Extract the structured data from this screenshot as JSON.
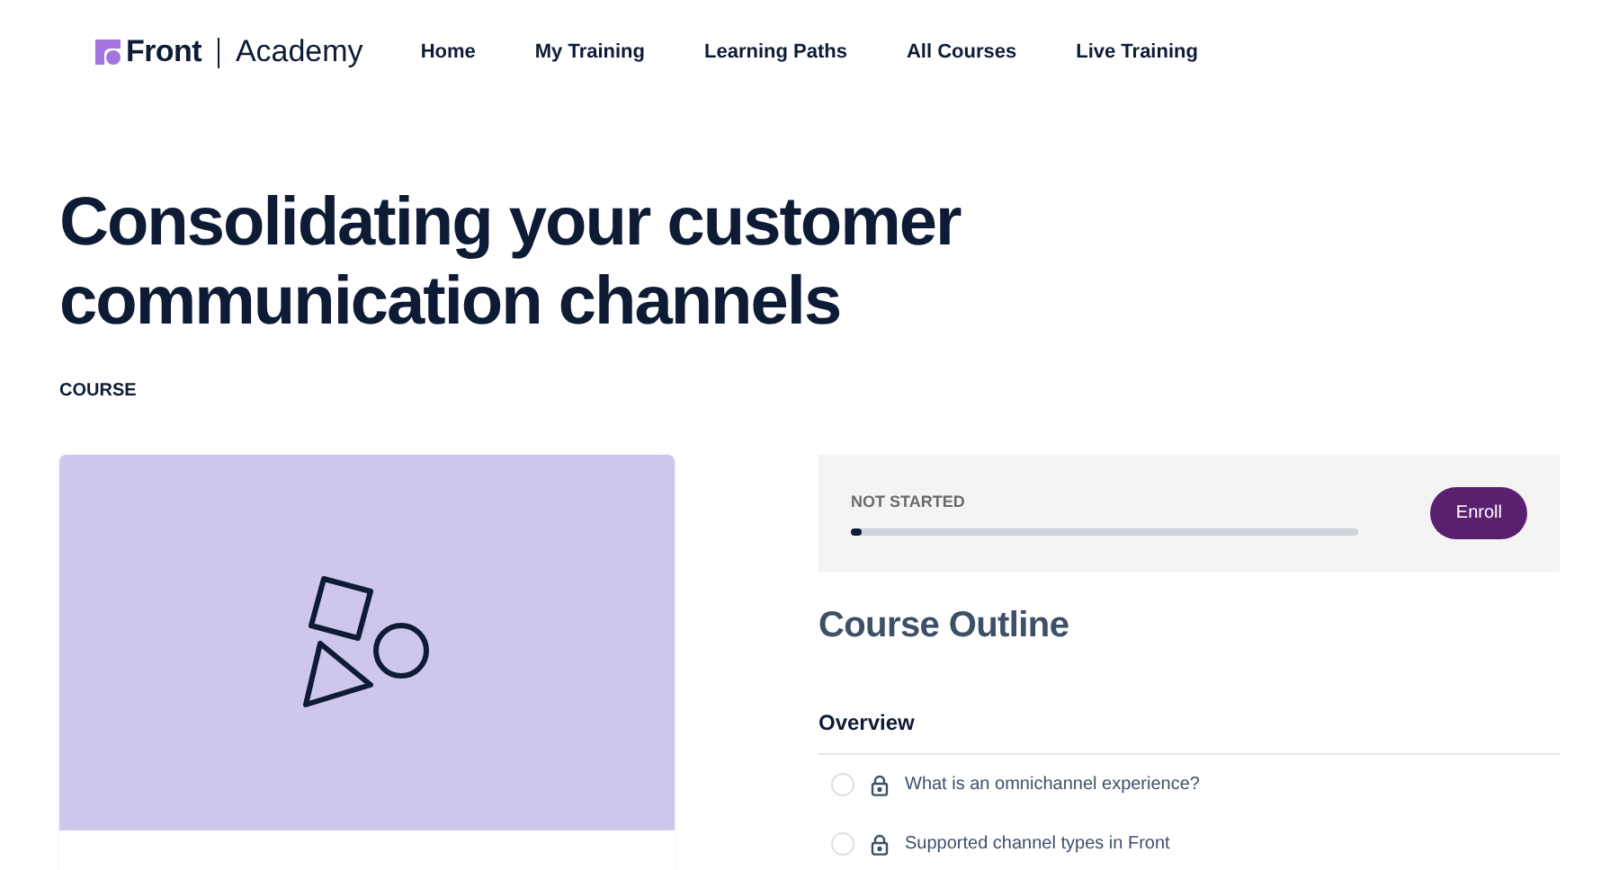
{
  "brand": {
    "name": "Front",
    "product": "Academy"
  },
  "nav": [
    {
      "label": "Home"
    },
    {
      "label": "My Training"
    },
    {
      "label": "Learning Paths"
    },
    {
      "label": "All Courses"
    },
    {
      "label": "Live Training"
    }
  ],
  "title": "Consolidating your customer communication channels",
  "type_label": "COURSE",
  "progress": {
    "status": "NOT STARTED",
    "level": 0.02,
    "button": "Enroll"
  },
  "outline": {
    "heading": "Course Outline",
    "sections": [
      {
        "title": "Overview",
        "lessons": [
          {
            "title": "What is an omnichannel experience?",
            "locked": true,
            "completed": false
          },
          {
            "title": "Supported channel types in Front",
            "locked": true,
            "completed": false
          }
        ]
      }
    ]
  }
}
